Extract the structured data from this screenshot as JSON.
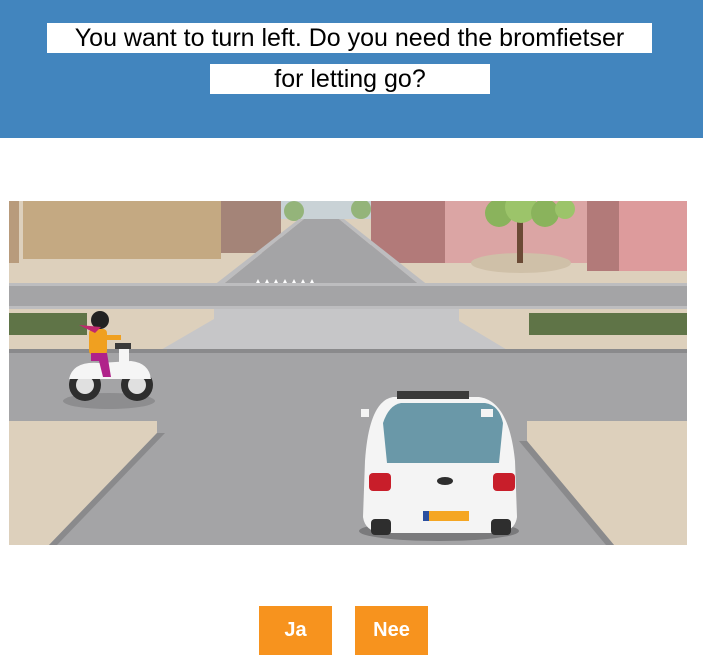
{
  "question": {
    "line1": "You want to turn left. Do you need the bromfietser",
    "line2": "for letting go?"
  },
  "scene": {
    "description_icon": "intersection-scene",
    "colors": {
      "header_bg": "#4285be",
      "button_bg": "#f7931e",
      "road": "#a4a4a6",
      "sidewalk": "#ddd0bc"
    }
  },
  "answers": {
    "yes_label": "Ja",
    "no_label": "Nee"
  }
}
